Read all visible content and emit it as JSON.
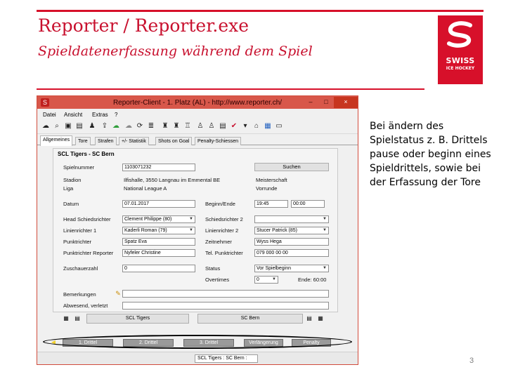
{
  "slide": {
    "title": "Reporter / Reporter.exe",
    "subtitle": "Spieldatenerfassung während dem Spiel",
    "description": "Bei ändern des Spielstatus z. B. Drittels pause oder beginn eines Spieldrittels, sowie bei der Erfassung der Tore",
    "page_number": "3",
    "accent_color": "#d7102a"
  },
  "logo": {
    "line1": "SWISS",
    "line2": "ICE HOCKEY"
  },
  "window": {
    "title": "Reporter-Client - 1. Platz (AL) - http://www.reporter.ch/",
    "min": "–",
    "max": "□",
    "close": "×",
    "app_icon": "S"
  },
  "menu": [
    "Datei",
    "Ansicht",
    "Extras",
    "?"
  ],
  "tabs": [
    "Allgemeines",
    "Tore",
    "Strafen",
    "+/- Statistik",
    "Shots on Goal",
    "Penalty-Schiessen"
  ],
  "form": {
    "panel_title": "SCL Tigers - SC Bern",
    "spielnummer_label": "Spielnummer",
    "spielnummer": "1103071232",
    "suchen": "Suchen",
    "stadion_label": "Stadion",
    "stadion": "Ilfishalle, 3550 Langnau im Emmental BE",
    "meisterschaft": "Meisterschaft",
    "liga_label": "Liga",
    "liga": "National League A",
    "vorrunde": "Vorrunde",
    "datum_label": "Datum",
    "datum": "07.01.2017",
    "beginn_label": "Beginn/Ende",
    "beginn": "19:45",
    "ende": "00:00",
    "hs_label": "Head Schiedsrichter",
    "hs": "Clement Philippe (80)",
    "sr2_label": "Schiedsrichter 2",
    "sr2": "",
    "ls1_label": "Linienrichter 1",
    "ls1": "Kaderli Roman (79)",
    "ls2_label": "Linienrichter 2",
    "ls2": "Stucer Patrick (85)",
    "pr_label": "Punktrichter",
    "pr": "Spatz Eva",
    "zn_label": "Zeitnehmer",
    "zn": "Wyss Hega",
    "prr_label": "Punktrichter Reporter",
    "prr": "Nyfeler Christine",
    "tel_label": "Tel. Punktrichter",
    "tel": "079 000 00 00",
    "zuschauer_label": "Zuschauerzahl",
    "zuschauer": "0",
    "status_label": "Status",
    "status": "Vor Spielbeginn",
    "overtimes_label": "Overtimes",
    "overtimes": "0",
    "ende_time": "Ende: 60:00",
    "bemerkungen_label": "Bemerkungen",
    "abwesend_label": "Abwesend, verletzt"
  },
  "teams": {
    "home": "SCL Tigers",
    "away": "SC Bern"
  },
  "periods": [
    "1. Drittel",
    "2. Drittel",
    "3. Drittel",
    "Verlängerung",
    "Penalty"
  ],
  "status_bar": "SCL Tigers : SC Bern  :"
}
